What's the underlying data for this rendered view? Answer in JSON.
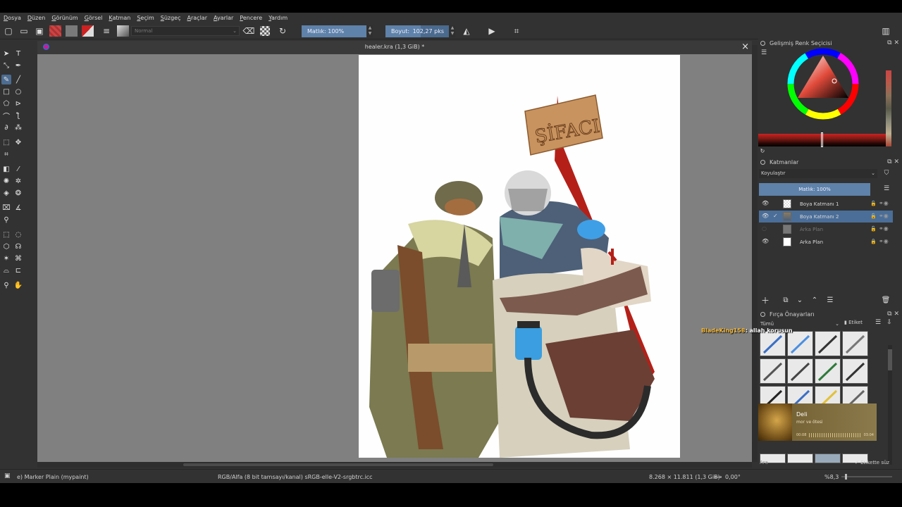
{
  "menu": [
    "Dosya",
    "Düzen",
    "Görünüm",
    "Görsel",
    "Katman",
    "Seçim",
    "Süzgeç",
    "Araçlar",
    "Ayarlar",
    "Pencere",
    "Yardım"
  ],
  "toolbar": {
    "blend_mode": "Normal",
    "opacity_label": "Matlık: 100%",
    "opacity_fraction": 1.0,
    "size_label": "Boyut:",
    "size_value": "102,27 pks",
    "size_fraction": 0.55
  },
  "document": {
    "title": "healer.kra (1,3 GiB) *",
    "sign_text": "ŞİFACI"
  },
  "color_panel": {
    "title": "Gelişmiş Renk Seçicisi"
  },
  "layers_panel": {
    "title": "Katmanlar",
    "blend": "Koyulaştır",
    "opacity_label": "Matlık:  100%",
    "layers": [
      {
        "name": "Boya Katmanı 1",
        "visible": true,
        "selected": false
      },
      {
        "name": "Boya Katmanı 2",
        "visible": true,
        "selected": true
      },
      {
        "name": "Arka Plan",
        "visible": false,
        "selected": false
      },
      {
        "name": "Arka Plan",
        "visible": true,
        "selected": false
      }
    ]
  },
  "brush_panel": {
    "title": "Fırça Önayarları",
    "filter": "Tümü",
    "tag_label": "Etiket",
    "search_placeholder": "Ara",
    "filter_by_tag": "Etikette süz"
  },
  "chat": {
    "user": "BladeKing158",
    "message": ": allah korusun"
  },
  "music": {
    "title": "Deli",
    "artist": "mor ve ötesi",
    "elapsed": "00:08",
    "total": "03:04"
  },
  "status": {
    "brush": "e) Marker Plain (mypaint)",
    "color_info": "RGB/Alfa (8 bit tamsayı/kanal)  sRGB-elle-V2-srgbtrc.icc",
    "dims": "8.268 × 11.811 (1,3 GiB)",
    "rotation": "0,00°",
    "zoom": "%8,3"
  }
}
